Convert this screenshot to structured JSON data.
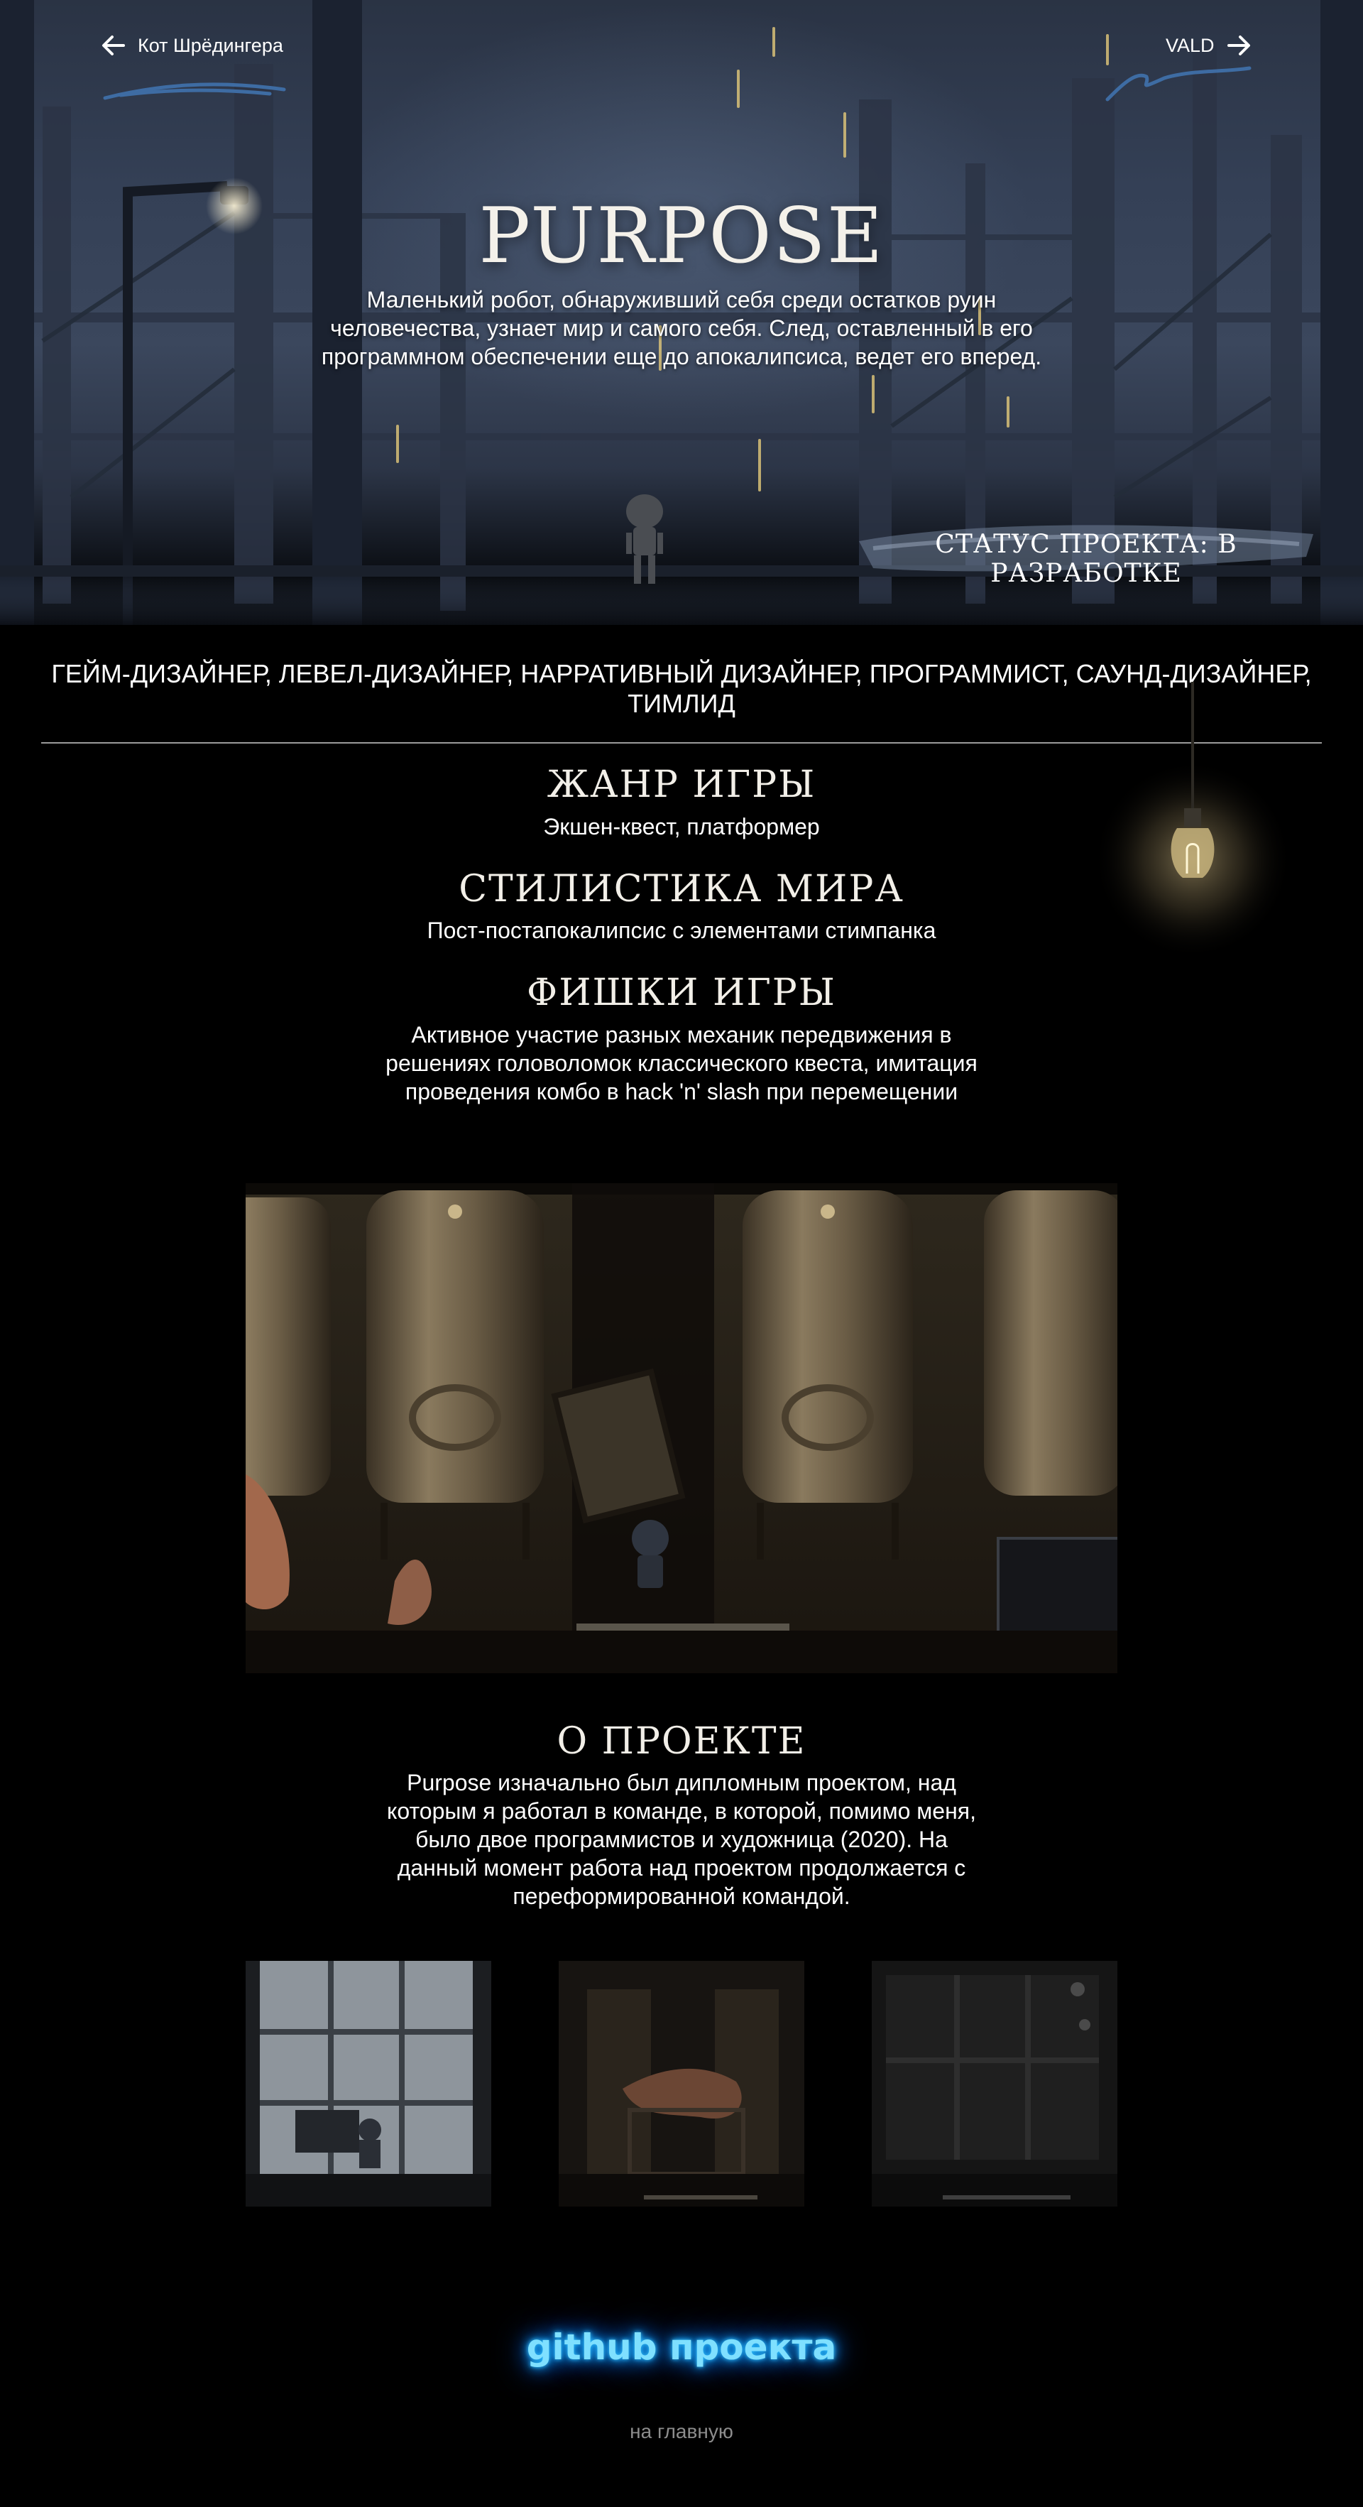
{
  "nav": {
    "prev_label": "Кот Шрёдингера",
    "next_label": "VALD"
  },
  "hero": {
    "title": "PURPOSE",
    "description": "Маленький робот, обнаруживший себя среди остатков руин человечества, узнает мир и самого себя. След, оставленный в его программном обеспечении еще до апокалипсиса, ведет его вперед.",
    "status": "СТАТУС ПРОЕКТА: В РАЗРАБОТКЕ"
  },
  "roles": "ГЕЙМ-ДИЗАЙНЕР, ЛЕВЕЛ-ДИЗАЙНЕР, НАРРАТИВНЫЙ ДИЗАЙНЕР, ПРОГРАММИСТ, САУНД-ДИЗАЙНЕР, ТИМЛИД",
  "sections": {
    "genre": {
      "title": "ЖАНР ИГРЫ",
      "text": "Экшен-квест, платформер"
    },
    "style": {
      "title": "СТИЛИСТИКА МИРА",
      "text": "Пост-постапокалипсис с элементами стимпанка"
    },
    "features": {
      "title": "ФИШКИ ИГРЫ",
      "text": "Активное участие разных механик передвижения в решениях головоломок классического квеста, имитация проведения комбо в hack 'n' slash при перемещении"
    },
    "about": {
      "title": "О ПРОЕКТЕ",
      "text": "Purpose изначально был дипломным проектом, над которым я работал в команде, в которой, помимо меня, было двое программистов и художница (2020). На данный момент работа над проектом продолжается с переформированной командой."
    }
  },
  "footer": {
    "github_label": "github проекта",
    "home_label": "на главную"
  },
  "colors": {
    "background": "#000000",
    "hero_sky": "#344056",
    "brush_accent": "#3f6fa8",
    "neon_blue": "#1aa8ff",
    "divider": "#9a9a9a",
    "muted_link": "#8c8c8c"
  },
  "icons": {
    "prev": "arrow-left-icon",
    "next": "arrow-right-icon",
    "lamp": "light-bulb-icon"
  }
}
